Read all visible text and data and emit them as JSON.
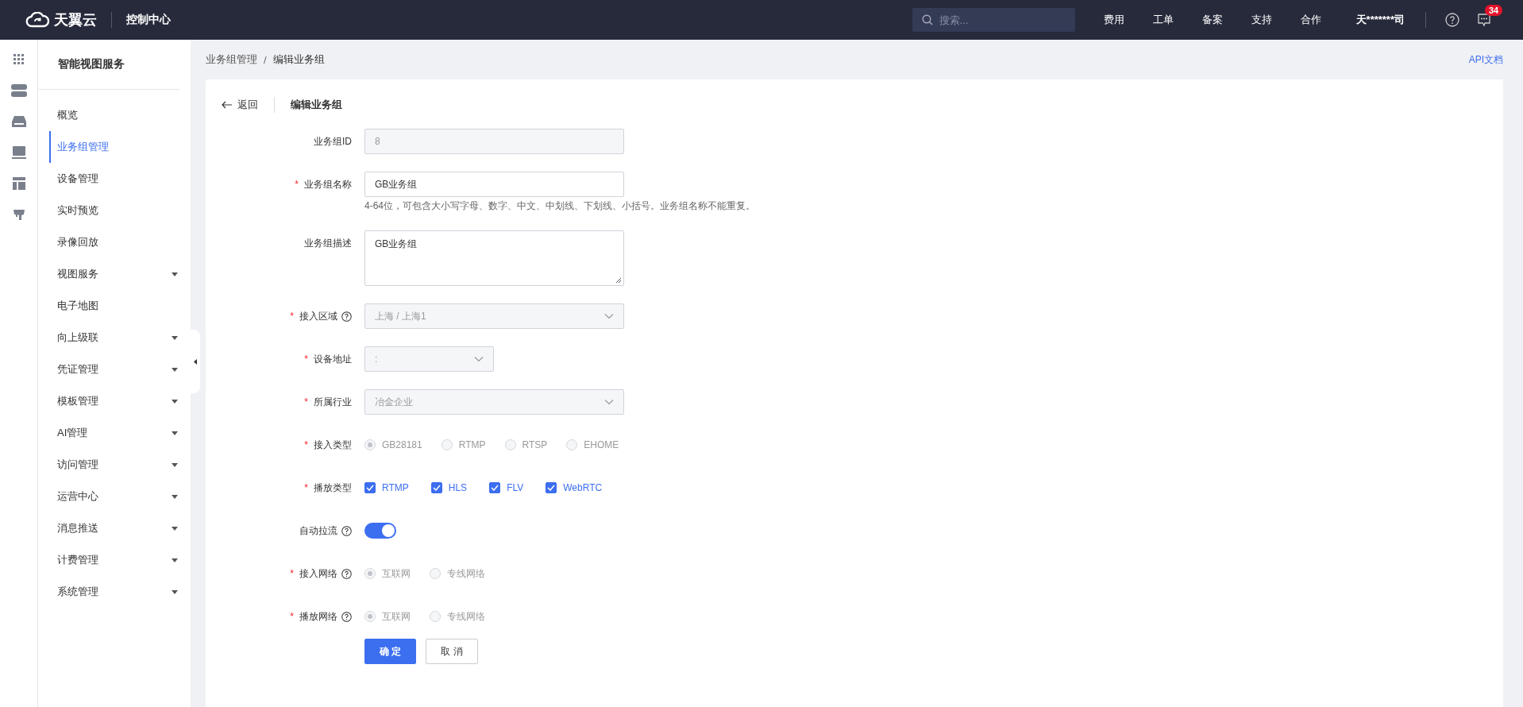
{
  "header": {
    "logo_text": "天翼云",
    "console_label": "控制中心",
    "search": {
      "placeholder": "搜索..."
    },
    "nav": [
      "费用",
      "工单",
      "备案",
      "支持",
      "合作"
    ],
    "user": "天*******司",
    "message_badge": "34"
  },
  "sidebar": {
    "title": "智能视图服务",
    "items": [
      {
        "label": "概览",
        "selected": false,
        "kind": "link"
      },
      {
        "label": "业务组管理",
        "selected": true,
        "kind": "link"
      },
      {
        "label": "设备管理",
        "selected": false,
        "kind": "link"
      },
      {
        "label": "实时预览",
        "selected": false,
        "kind": "link"
      },
      {
        "label": "录像回放",
        "selected": false,
        "kind": "link"
      },
      {
        "label": "视图服务",
        "selected": false,
        "kind": "group"
      },
      {
        "label": "电子地图",
        "selected": false,
        "kind": "link"
      },
      {
        "label": "向上级联",
        "selected": false,
        "kind": "group"
      },
      {
        "label": "凭证管理",
        "selected": false,
        "kind": "group"
      },
      {
        "label": "模板管理",
        "selected": false,
        "kind": "group"
      },
      {
        "label": "AI管理",
        "selected": false,
        "kind": "group"
      },
      {
        "label": "访问管理",
        "selected": false,
        "kind": "group"
      },
      {
        "label": "运营中心",
        "selected": false,
        "kind": "group"
      },
      {
        "label": "消息推送",
        "selected": false,
        "kind": "group"
      },
      {
        "label": "计费管理",
        "selected": false,
        "kind": "group"
      },
      {
        "label": "系统管理",
        "selected": false,
        "kind": "group"
      }
    ]
  },
  "breadcrumb": {
    "items": [
      "业务组管理",
      "编辑业务组"
    ],
    "separators": [
      "/"
    ]
  },
  "api_link": "API文档",
  "form": {
    "back": "返回",
    "title": "编辑业务组",
    "fields": [
      {
        "kind": "text",
        "label": "业务组ID",
        "disabled": true,
        "value": "8"
      },
      {
        "kind": "text",
        "label": "业务组名称",
        "required_mark": "*",
        "disabled": false,
        "value": "GB业务组",
        "hint": "4-64位，可包含大小写字母、数字、中文、中划线、下划线、小括号。业务组名称不能重复。"
      },
      {
        "kind": "textarea",
        "label": "业务组描述",
        "disabled": false,
        "value": "GB业务组"
      },
      {
        "kind": "select",
        "label": "接入区域",
        "required_mark": "*",
        "help": true,
        "disabled": true,
        "value": "上海 / 上海1"
      },
      {
        "kind": "select",
        "label": "设备地址",
        "required_mark": "*",
        "disabled": true,
        "value": ":",
        "narrow": true
      },
      {
        "kind": "select",
        "label": "所属行业",
        "required_mark": "*",
        "disabled": true,
        "value": "冶金企业"
      },
      {
        "kind": "radio",
        "label": "接入类型",
        "required_mark": "*",
        "disabled": true,
        "options": [
          {
            "label": "GB28181",
            "selected": true
          },
          {
            "label": "RTMP",
            "selected": false
          },
          {
            "label": "RTSP",
            "selected": false
          },
          {
            "label": "EHOME",
            "selected": false
          }
        ]
      },
      {
        "kind": "checkbox",
        "label": "播放类型",
        "required_mark": "*",
        "options": [
          {
            "label": "RTMP",
            "checked": true
          },
          {
            "label": "HLS",
            "checked": true
          },
          {
            "label": "FLV",
            "checked": true
          },
          {
            "label": "WebRTC",
            "checked": true
          }
        ]
      },
      {
        "kind": "switch",
        "label": "自动拉流",
        "help": true,
        "on": true
      },
      {
        "kind": "radio",
        "label": "接入网络",
        "required_mark": "*",
        "help": true,
        "disabled": true,
        "options": [
          {
            "label": "互联网",
            "selected": true
          },
          {
            "label": "专线网络",
            "selected": false
          }
        ]
      },
      {
        "kind": "radio",
        "label": "播放网络",
        "required_mark": "*",
        "help": true,
        "disabled": true,
        "options": [
          {
            "label": "互联网",
            "selected": true
          },
          {
            "label": "专线网络",
            "selected": false
          }
        ]
      }
    ],
    "buttons": [
      {
        "label": "确 定",
        "kind": "primary"
      },
      {
        "label": "取 消",
        "kind": "default"
      }
    ]
  }
}
